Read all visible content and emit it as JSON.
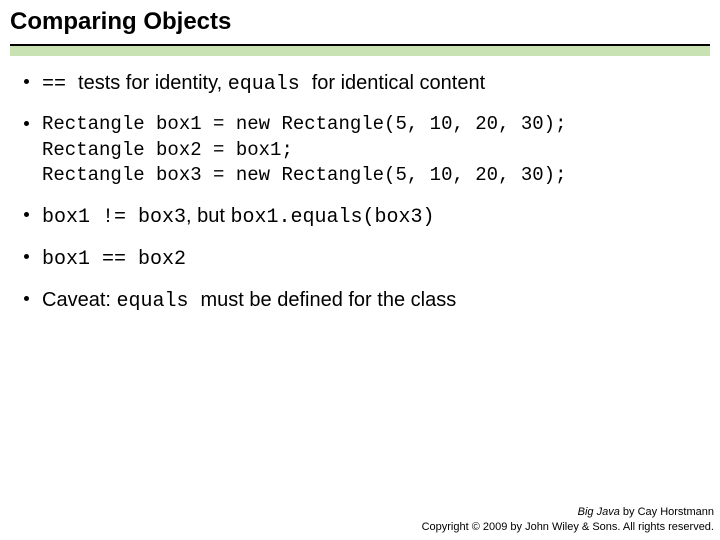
{
  "title": "Comparing Objects",
  "bullets": {
    "b1": {
      "t1": "== ",
      "t2": "tests for identity, ",
      "t3": "equals ",
      "t4": "for identical content"
    },
    "b2": {
      "code": "Rectangle box1 = new Rectangle(5, 10, 20, 30);\nRectangle box2 = box1;\nRectangle box3 = new Rectangle(5, 10, 20, 30);"
    },
    "b3": {
      "t1": "box1 != box3",
      "t2": ", but ",
      "t3": "box1.equals(box3)"
    },
    "b4": {
      "t1": "box1 == box2"
    },
    "b5": {
      "t1": "Caveat: ",
      "t2": "equals ",
      "t3": "must be defined for the class"
    }
  },
  "footer": {
    "book": "Big Java",
    "byline": " by Cay Horstmann",
    "copyright": "Copyright © 2009 by John Wiley & Sons.  All rights reserved."
  }
}
